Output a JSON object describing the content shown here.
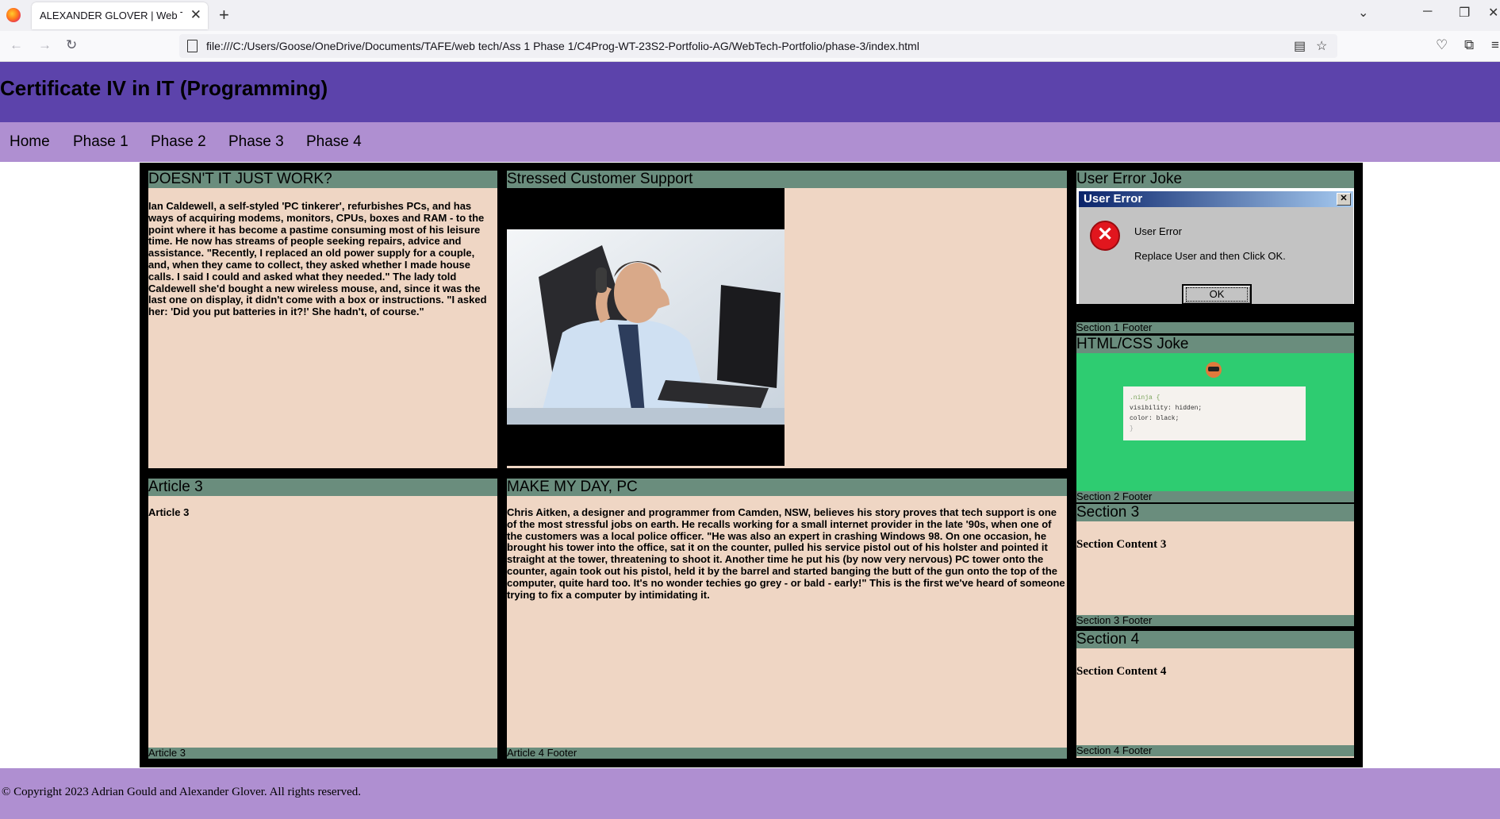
{
  "browser": {
    "tab_title": "ALEXANDER GLOVER | Web Tech | C",
    "tab_close": "✕",
    "new_tab": "+",
    "url": "file:///C:/Users/Goose/OneDrive/Documents/TAFE/web tech/Ass 1 Phase 1/C4Prog-WT-23S2-Portfolio-AG/WebTech-Portfolio/phase-3/index.html"
  },
  "site": {
    "title": "Certificate IV in IT (Programming)",
    "menu": [
      "Home",
      "Phase 1",
      "Phase 2",
      "Phase 3",
      "Phase 4"
    ],
    "footer": "© Copyright 2023 Adrian Gould and Alexander Glover. All rights reserved."
  },
  "article1": {
    "heading": "DOESN'T IT JUST WORK?",
    "body": "Ian Caldewell, a self-styled 'PC tinkerer', refurbishes PCs, and has ways of acquiring modems, monitors, CPUs, boxes and RAM - to the point where it has become a pastime consuming most of his leisure time. He now has streams of people seeking repairs, advice and assistance. \"Recently, I replaced an old power supply for a couple, and, when they came to collect, they asked whether I made house calls. I said I could and asked what they needed.\" The lady told Caldewell she'd bought a new wireless mouse, and, since it was the last one on display, it didn't come with a box or instructions. \"I asked her: 'Did you put batteries in it?!' She hadn't, of course.\""
  },
  "article2": {
    "heading": "Stressed Customer Support"
  },
  "article3": {
    "heading": "Article 3",
    "body": "Article 3",
    "footer": "Article 3"
  },
  "article4": {
    "heading": "MAKE MY DAY, PC",
    "body": "Chris Aitken, a designer and programmer from Camden, NSW, believes his story proves that tech support is one of the most stressful jobs on earth. He recalls working for a small internet provider in the late '90s, when one of the customers was a local police officer. \"He was also an expert in crashing Windows 98. On one occasion, he brought his tower into the office, sat it on the counter, pulled his service pistol out of his holster and pointed it straight at the tower, threatening to shoot it. Another time he put his (by now very nervous) PC tower onto the counter, again took out his pistol, held it by the barrel and started banging the butt of the gun onto the top of the computer, quite hard too. It's no wonder techies go grey - or bald - early!\" This is the first we've heard of someone trying to fix a computer by intimidating it.",
    "footer": "Article 4 Footer"
  },
  "section1": {
    "heading": "User Error Joke",
    "dialog_title": "User Error",
    "dialog_close": "✕",
    "dialog_icon": "✕",
    "dialog_line1": "User Error",
    "dialog_line2": "Replace User and then Click OK.",
    "dialog_ok": "OK",
    "footer": "Section 1 Footer"
  },
  "section2": {
    "heading": "HTML/CSS Joke",
    "code": [
      ".ninja {",
      "visibility: hidden;",
      "color: black;",
      "}"
    ],
    "footer": "Section 2 Footer"
  },
  "section3": {
    "heading": "Section 3",
    "content": "Section Content 3",
    "footer": "Section 3 Footer"
  },
  "section4": {
    "heading": "Section 4",
    "content": "Section Content 4",
    "footer": "Section 4 Footer"
  },
  "colors": {
    "header": "#5c43ab",
    "menu": "#af8fd1",
    "panel": "#efd6c4",
    "bar": "#6a8d7d",
    "joke_bg": "#2ecc71"
  }
}
